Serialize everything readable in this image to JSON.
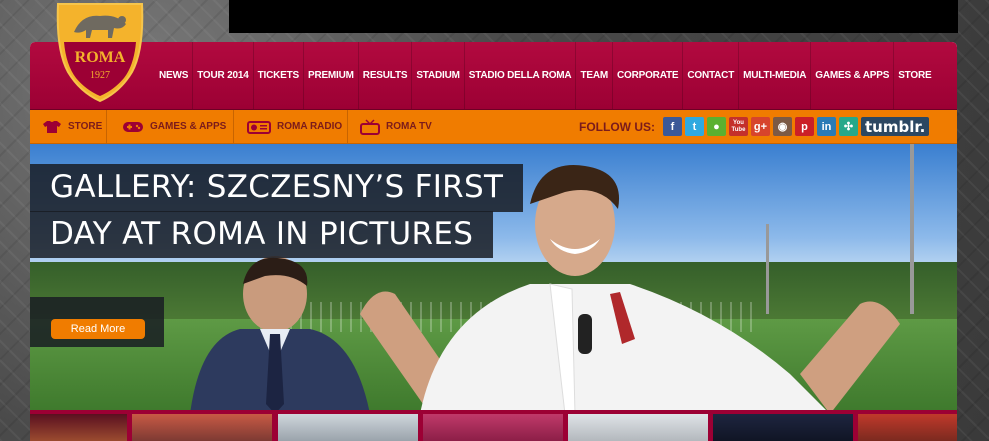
{
  "logo": {
    "text": "ROMA",
    "year": "1927"
  },
  "nav": [
    "NEWS",
    "TOUR 2014",
    "TICKETS",
    "PREMIUM",
    "RESULTS",
    "STADIUM",
    "STADIO DELLA ROMA",
    "TEAM",
    "CORPORATE",
    "CONTACT",
    "MULTI-MEDIA",
    "GAMES & APPS",
    "STORE"
  ],
  "subnav": {
    "store": "STORE",
    "games": "GAMES & APPS",
    "radio": "ROMA RADIO",
    "tv": "ROMA TV",
    "follow": "FOLLOW US:"
  },
  "social": [
    {
      "name": "facebook-icon",
      "glyph": "f",
      "color": "#3b5998"
    },
    {
      "name": "twitter-icon",
      "glyph": "t",
      "color": "#2fa9e0"
    },
    {
      "name": "wechat-icon",
      "glyph": "●",
      "color": "#5bb030"
    },
    {
      "name": "youtube-icon",
      "glyph": "You Tube",
      "color": "#c4302b"
    },
    {
      "name": "google-plus-icon",
      "glyph": "g+",
      "color": "#d7442c"
    },
    {
      "name": "instagram-icon",
      "glyph": "◉",
      "color": "#7c5a45"
    },
    {
      "name": "pinterest-icon",
      "glyph": "p",
      "color": "#cb2027"
    },
    {
      "name": "linkedin-icon",
      "glyph": "in",
      "color": "#2a7bb6"
    },
    {
      "name": "other-social-icon",
      "glyph": "✣",
      "color": "#26a88a"
    }
  ],
  "tumblr": "tumblr.",
  "hero": {
    "line1": "GALLERY: SZCZESNY’S FIRST",
    "line2": "DAY AT ROMA IN PICTURES",
    "readmore": "Read More"
  },
  "colors": {
    "crimson": "#9c0034",
    "orange": "#f07c00"
  }
}
